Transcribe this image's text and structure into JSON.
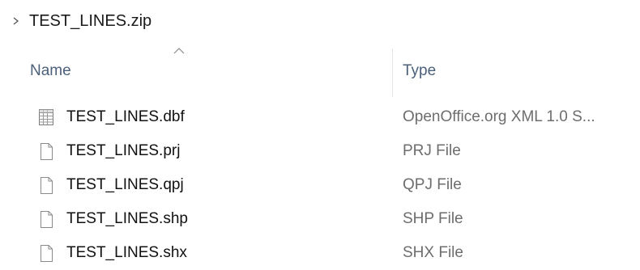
{
  "breadcrumb": {
    "chevron_icon": "chevron-right-icon",
    "label": "TEST_LINES.zip"
  },
  "columns": {
    "name_label": "Name",
    "type_label": "Type",
    "sort_indicator_icon": "sort-up-icon"
  },
  "files": [
    {
      "name": "TEST_LINES.dbf",
      "type": "OpenOffice.org XML 1.0 S...",
      "icon": "spreadsheet-file-icon"
    },
    {
      "name": "TEST_LINES.prj",
      "type": "PRJ File",
      "icon": "blank-file-icon"
    },
    {
      "name": "TEST_LINES.qpj",
      "type": "QPJ File",
      "icon": "blank-file-icon"
    },
    {
      "name": "TEST_LINES.shp",
      "type": "SHP File",
      "icon": "blank-file-icon"
    },
    {
      "name": "TEST_LINES.shx",
      "type": "SHX File",
      "icon": "blank-file-icon"
    }
  ],
  "colors": {
    "header_text": "#4c607a",
    "type_text": "#6d6d6d",
    "icon_stroke": "#8a8a8a"
  }
}
